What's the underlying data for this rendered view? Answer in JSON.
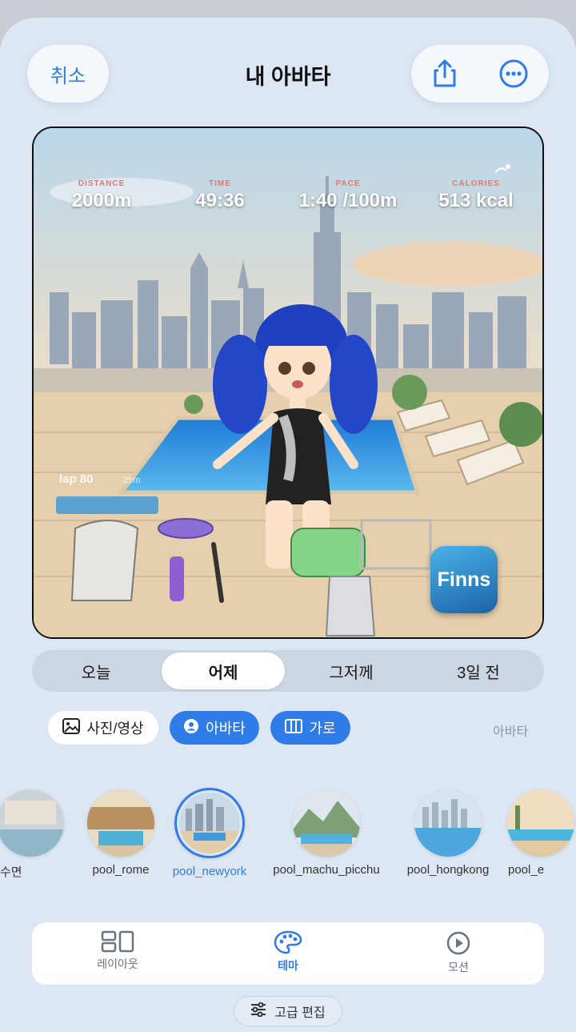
{
  "header": {
    "cancel_label": "취소",
    "title": "내 아바타",
    "share_icon": "share-icon",
    "more_icon": "more-icon"
  },
  "scene": {
    "stats": [
      {
        "label": "DISTANCE",
        "value": "2000m"
      },
      {
        "label": "TIME",
        "value": "49:36"
      },
      {
        "label": "PACE",
        "value": "1:40 /100m"
      },
      {
        "label": "CALORIES",
        "value": "513 kcal"
      }
    ],
    "lap_text": "lap 80",
    "lap_sub": "25m",
    "badge_label": "Finns"
  },
  "day_tabs": {
    "items": [
      "오늘",
      "어제",
      "그저께",
      "3일 전"
    ],
    "selected": "어제"
  },
  "chips": {
    "photo": "사진/영상",
    "avatar": "아바타",
    "landscape": "가로",
    "caption": "아바타"
  },
  "themes": [
    {
      "name": "수면"
    },
    {
      "name": "pool_rome"
    },
    {
      "name": "pool_newyork",
      "selected": true
    },
    {
      "name": "pool_machu_picchu"
    },
    {
      "name": "pool_hongkong"
    },
    {
      "name": "pool_e"
    }
  ],
  "tabs": {
    "layout": "레이아웃",
    "theme": "테마",
    "motion": "모션",
    "active": "테마"
  },
  "advanced_edit": "고급 편집",
  "colors": {
    "accent": "#2f7be8",
    "background": "#dde6f3",
    "stat_label": "#e9776a"
  }
}
